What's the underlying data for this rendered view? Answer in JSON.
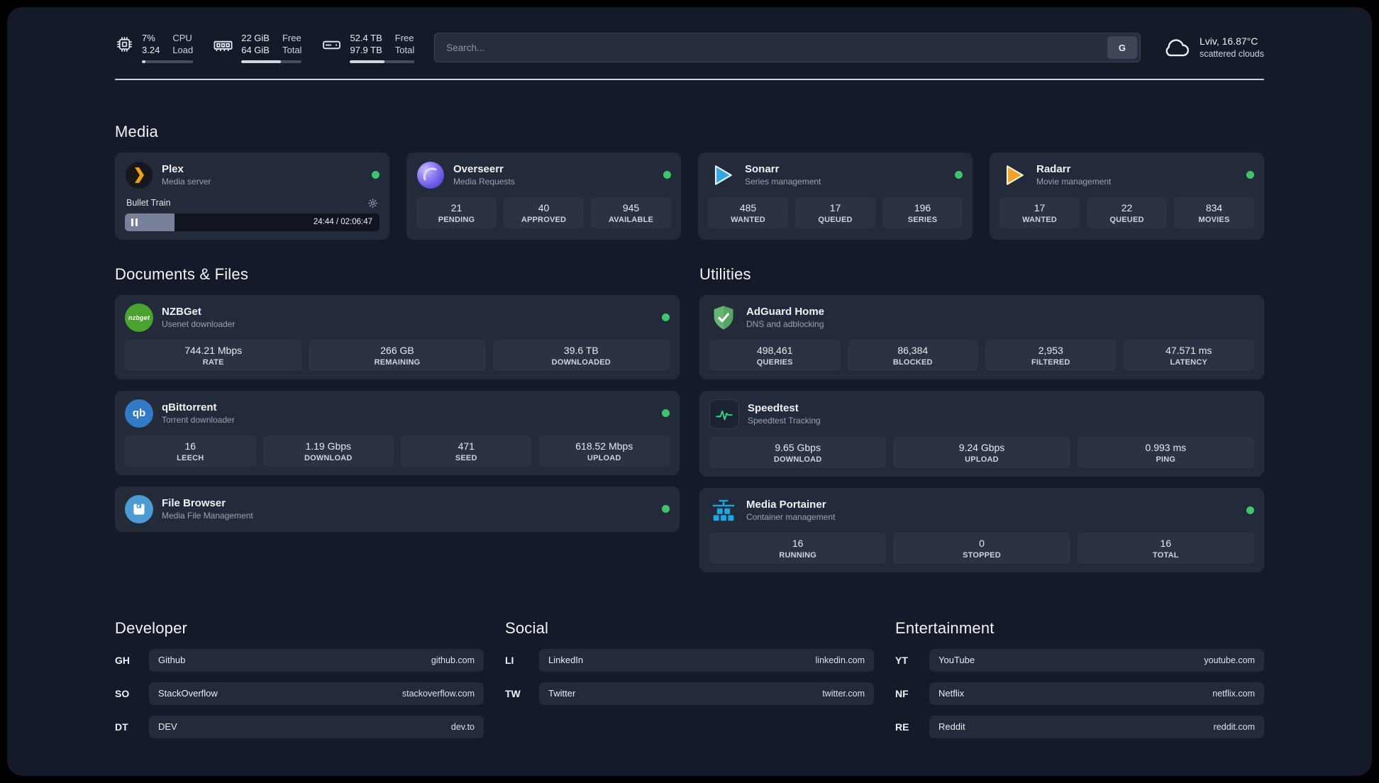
{
  "theme": {
    "bg-app": "#151a29",
    "card": "#232a39",
    "tile": "#2a3243",
    "text-primary": "#eef1f6",
    "text-secondary": "#9aa3b4",
    "status-green": "#3ec46d",
    "plex-orange": "#e9a40d",
    "sonarr-blue": "#36a6e0",
    "radarr-gold": "#f0a32a",
    "portainer-blue": "#1ba8e0",
    "speedtest-green": "#3ad07e"
  },
  "header": {
    "cpu": {
      "percent": "7%",
      "load": "3.24",
      "label_top": "CPU",
      "label_bottom": "Load",
      "bar_percent": 7
    },
    "ram": {
      "free": "22 GiB",
      "total": "64 GiB",
      "label_top": "Free",
      "label_bottom": "Total",
      "bar_percent": 66
    },
    "disk": {
      "free": "52.4 TB",
      "total": "97.9 TB",
      "label_top": "Free",
      "label_bottom": "Total",
      "bar_percent": 54
    },
    "search": {
      "placeholder": "Search...",
      "engine_button": "G"
    },
    "weather": {
      "location": "Lviv, 16.87°C",
      "condition": "scattered clouds"
    }
  },
  "sections": {
    "media": {
      "title": "Media",
      "cards": [
        {
          "name": "Plex",
          "desc": "Media server",
          "icon": "plex-icon",
          "status": "online",
          "now_playing": {
            "title": "Bullet Train",
            "time": "24:44 / 02:06:47",
            "progress_percent": 19.5
          }
        },
        {
          "name": "Overseerr",
          "desc": "Media Requests",
          "icon": "overseerr-icon",
          "status": "online",
          "stats": [
            {
              "value": "21",
              "label": "PENDING"
            },
            {
              "value": "40",
              "label": "APPROVED"
            },
            {
              "value": "945",
              "label": "AVAILABLE"
            }
          ]
        },
        {
          "name": "Sonarr",
          "desc": "Series management",
          "icon": "sonarr-icon",
          "status": "online",
          "stats": [
            {
              "value": "485",
              "label": "WANTED"
            },
            {
              "value": "17",
              "label": "QUEUED"
            },
            {
              "value": "196",
              "label": "SERIES"
            }
          ]
        },
        {
          "name": "Radarr",
          "desc": "Movie management",
          "icon": "radarr-icon",
          "status": "online",
          "stats": [
            {
              "value": "17",
              "label": "WANTED"
            },
            {
              "value": "22",
              "label": "QUEUED"
            },
            {
              "value": "834",
              "label": "MOVIES"
            }
          ]
        }
      ]
    },
    "documents": {
      "title": "Documents & Files",
      "cards": [
        {
          "name": "NZBGet",
          "desc": "Usenet downloader",
          "icon": "nzbget-icon",
          "status": "online",
          "stats": [
            {
              "value": "744.21 Mbps",
              "label": "RATE"
            },
            {
              "value": "266 GB",
              "label": "REMAINING"
            },
            {
              "value": "39.6 TB",
              "label": "DOWNLOADED"
            }
          ]
        },
        {
          "name": "qBittorrent",
          "desc": "Torrent downloader",
          "icon": "qbittorrent-icon",
          "status": "online",
          "stats": [
            {
              "value": "16",
              "label": "LEECH"
            },
            {
              "value": "1.19 Gbps",
              "label": "DOWNLOAD"
            },
            {
              "value": "471",
              "label": "SEED"
            },
            {
              "value": "618.52 Mbps",
              "label": "UPLOAD"
            }
          ]
        },
        {
          "name": "File Browser",
          "desc": "Media File Management",
          "icon": "filebrowser-icon",
          "status": "online",
          "stats": []
        }
      ]
    },
    "utilities": {
      "title": "Utilities",
      "cards": [
        {
          "name": "AdGuard Home",
          "desc": "DNS and adblocking",
          "icon": "adguard-icon",
          "stats": [
            {
              "value": "498,461",
              "label": "QUERIES"
            },
            {
              "value": "86,384",
              "label": "BLOCKED"
            },
            {
              "value": "2,953",
              "label": "FILTERED"
            },
            {
              "value": "47.571 ms",
              "label": "LATENCY"
            }
          ]
        },
        {
          "name": "Speedtest",
          "desc": "Speedtest Tracking",
          "icon": "speedtest-icon",
          "stats": [
            {
              "value": "9.65 Gbps",
              "label": "DOWNLOAD"
            },
            {
              "value": "9.24 Gbps",
              "label": "UPLOAD"
            },
            {
              "value": "0.993 ms",
              "label": "PING"
            }
          ]
        },
        {
          "name": "Media Portainer",
          "desc": "Container management",
          "icon": "portainer-icon",
          "status": "online",
          "stats": [
            {
              "value": "16",
              "label": "RUNNING"
            },
            {
              "value": "0",
              "label": "STOPPED"
            },
            {
              "value": "16",
              "label": "TOTAL"
            }
          ]
        }
      ]
    },
    "bookmarks": [
      {
        "title": "Developer",
        "links": [
          {
            "abbr": "GH",
            "name": "Github",
            "url": "github.com"
          },
          {
            "abbr": "SO",
            "name": "StackOverflow",
            "url": "stackoverflow.com"
          },
          {
            "abbr": "DT",
            "name": "DEV",
            "url": "dev.to"
          }
        ]
      },
      {
        "title": "Social",
        "links": [
          {
            "abbr": "LI",
            "name": "LinkedIn",
            "url": "linkedin.com"
          },
          {
            "abbr": "TW",
            "name": "Twitter",
            "url": "twitter.com"
          }
        ]
      },
      {
        "title": "Entertainment",
        "links": [
          {
            "abbr": "YT",
            "name": "YouTube",
            "url": "youtube.com"
          },
          {
            "abbr": "NF",
            "name": "Netflix",
            "url": "netflix.com"
          },
          {
            "abbr": "RE",
            "name": "Reddit",
            "url": "reddit.com"
          }
        ]
      }
    ]
  }
}
